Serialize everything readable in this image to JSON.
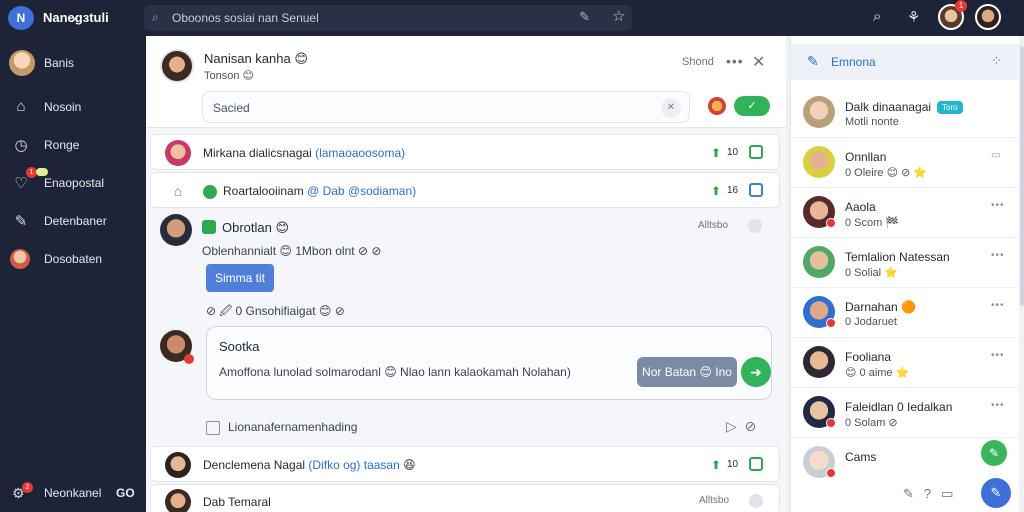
{
  "app": {
    "title": "Nane̷ɡɜtuli",
    "logo_text": "N"
  },
  "search": {
    "placeholder": "Oboonos sosiai nan Senuel"
  },
  "sidebar": {
    "items": [
      {
        "label": "Banis"
      },
      {
        "label": "Nosoin"
      },
      {
        "label": "Ronge"
      },
      {
        "label": "Enaopostal",
        "badge": "1"
      },
      {
        "label": "Detenbaner"
      },
      {
        "label": "Dosobaten"
      }
    ],
    "bottom": {
      "label": "Neonkanel",
      "count": "GO",
      "badge": "2"
    }
  },
  "topbar": {
    "badge": "1"
  },
  "conversation": {
    "name": "Nanisan kanha 😊",
    "sub": "Tonson 😊",
    "share_label": "Shond",
    "compose_placeholder": "Sacied",
    "send_label": "✓"
  },
  "rows": [
    {
      "text": "Mirkana dialicsnagai",
      "tag": "(lamaoaoosoma)",
      "count": "10"
    },
    {
      "text": "Roartalooiinam",
      "tag": "@ Dab @sodiaman)",
      "count": "16"
    }
  ],
  "thread": {
    "name": "Obrotlan 😊",
    "time": "Alltsbo",
    "body": "Oblenhannialt 😊 1Mbon olnt ⊘ ⊘",
    "reply_label": "Simma tit",
    "reaction": "0 Gnsohifiaigat 😊 ⊘",
    "quote": {
      "title": "Sootka",
      "body": "Amoffona lunolad solmarodanl 😊 Nlao lann kalaokamah Nolahan)",
      "button": "Nor Batan 😊 Ino"
    },
    "footer": "Lionanafernamenhading"
  },
  "bottom_rows": [
    {
      "text": "Denclemena Nagal",
      "tag": "(Difko og) taasan",
      "emoji": "😆",
      "count": "10"
    },
    {
      "text": "Dab Temaral",
      "time": "Alltsbo"
    }
  ],
  "right_panel": {
    "title": "Emnona",
    "contacts": [
      {
        "name": "Dalk dinaanagai",
        "status": "Motli nonte",
        "pill": "Toro"
      },
      {
        "name": "Onnllan",
        "status": "0 Oleire 😊 ⊘ ⭐"
      },
      {
        "name": "Aaola",
        "status": "0 Scom 🏁"
      },
      {
        "name": "Temlalion Natessan",
        "status": "0 Solial ⭐"
      },
      {
        "name": "Darnahan 🟠",
        "status": "0 Jodaruet"
      },
      {
        "name": "Fooliana",
        "status": "😊 0 aime ⭐"
      },
      {
        "name": "Faleidlan 0 Iedalkan",
        "status": "0 Solam ⊘"
      },
      {
        "name": "Cams",
        "status": ""
      }
    ]
  },
  "colors": {
    "sidebar": "#1d2438",
    "accent": "#3f6fd8",
    "green": "#32b35a",
    "link": "#2b6fd4"
  }
}
